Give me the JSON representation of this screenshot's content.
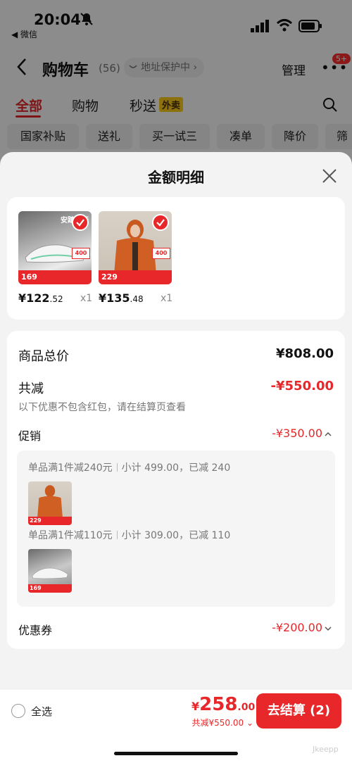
{
  "status_bar": {
    "time": "20:04",
    "back_app": "◀ 微信"
  },
  "header": {
    "title": "购物车",
    "count": "(56)",
    "protect_label": "地址保护中 ›",
    "manage": "管理",
    "more_badge": "5+"
  },
  "tabs": [
    {
      "label": "全部"
    },
    {
      "label": "购物"
    },
    {
      "label": "秒送"
    }
  ],
  "tab_badge": "外卖",
  "chips": [
    {
      "label": "国家补贴"
    },
    {
      "label": "送礼"
    },
    {
      "label": "买一试三"
    },
    {
      "label": "凑单"
    },
    {
      "label": "降价"
    },
    {
      "label": "筛"
    }
  ],
  "sheet": {
    "title": "金额明细",
    "items": [
      {
        "price_main": "¥122",
        "price_dec": ".52",
        "qty": "x1",
        "strip": "169",
        "tag": "400",
        "brand_text": "安踏旗行"
      },
      {
        "price_main": "¥135",
        "price_dec": ".48",
        "qty": "x1",
        "strip": "229",
        "tag": "400"
      }
    ],
    "goods_total_label": "商品总价",
    "goods_total_value": "¥808.00",
    "reduce_label": "共减",
    "reduce_value": "-¥550.00",
    "reduce_note": "以下优惠不包含红包，请在结算页查看",
    "promo_label": "促销",
    "promo_value": "-¥350.00",
    "promo_rules": [
      {
        "rule": "单品满1件减240元",
        "detail": "小计 499.00，已减 240",
        "strip": "229"
      },
      {
        "rule": "单品满1件减110元",
        "detail": "小计 309.00，已减 110",
        "strip": "169"
      }
    ],
    "coupon_label": "优惠券",
    "coupon_value": "-¥200.00"
  },
  "bottom_bar": {
    "select_all": "全选",
    "total_currency": "¥",
    "total_int": "258",
    "total_dec": ".00",
    "saved": "共减¥550.00",
    "checkout": "去结算 (2)"
  },
  "watermark": "Jkeepp",
  "colors": {
    "accent": "#e7272a",
    "badge_yellow": "#ffcf1b"
  }
}
